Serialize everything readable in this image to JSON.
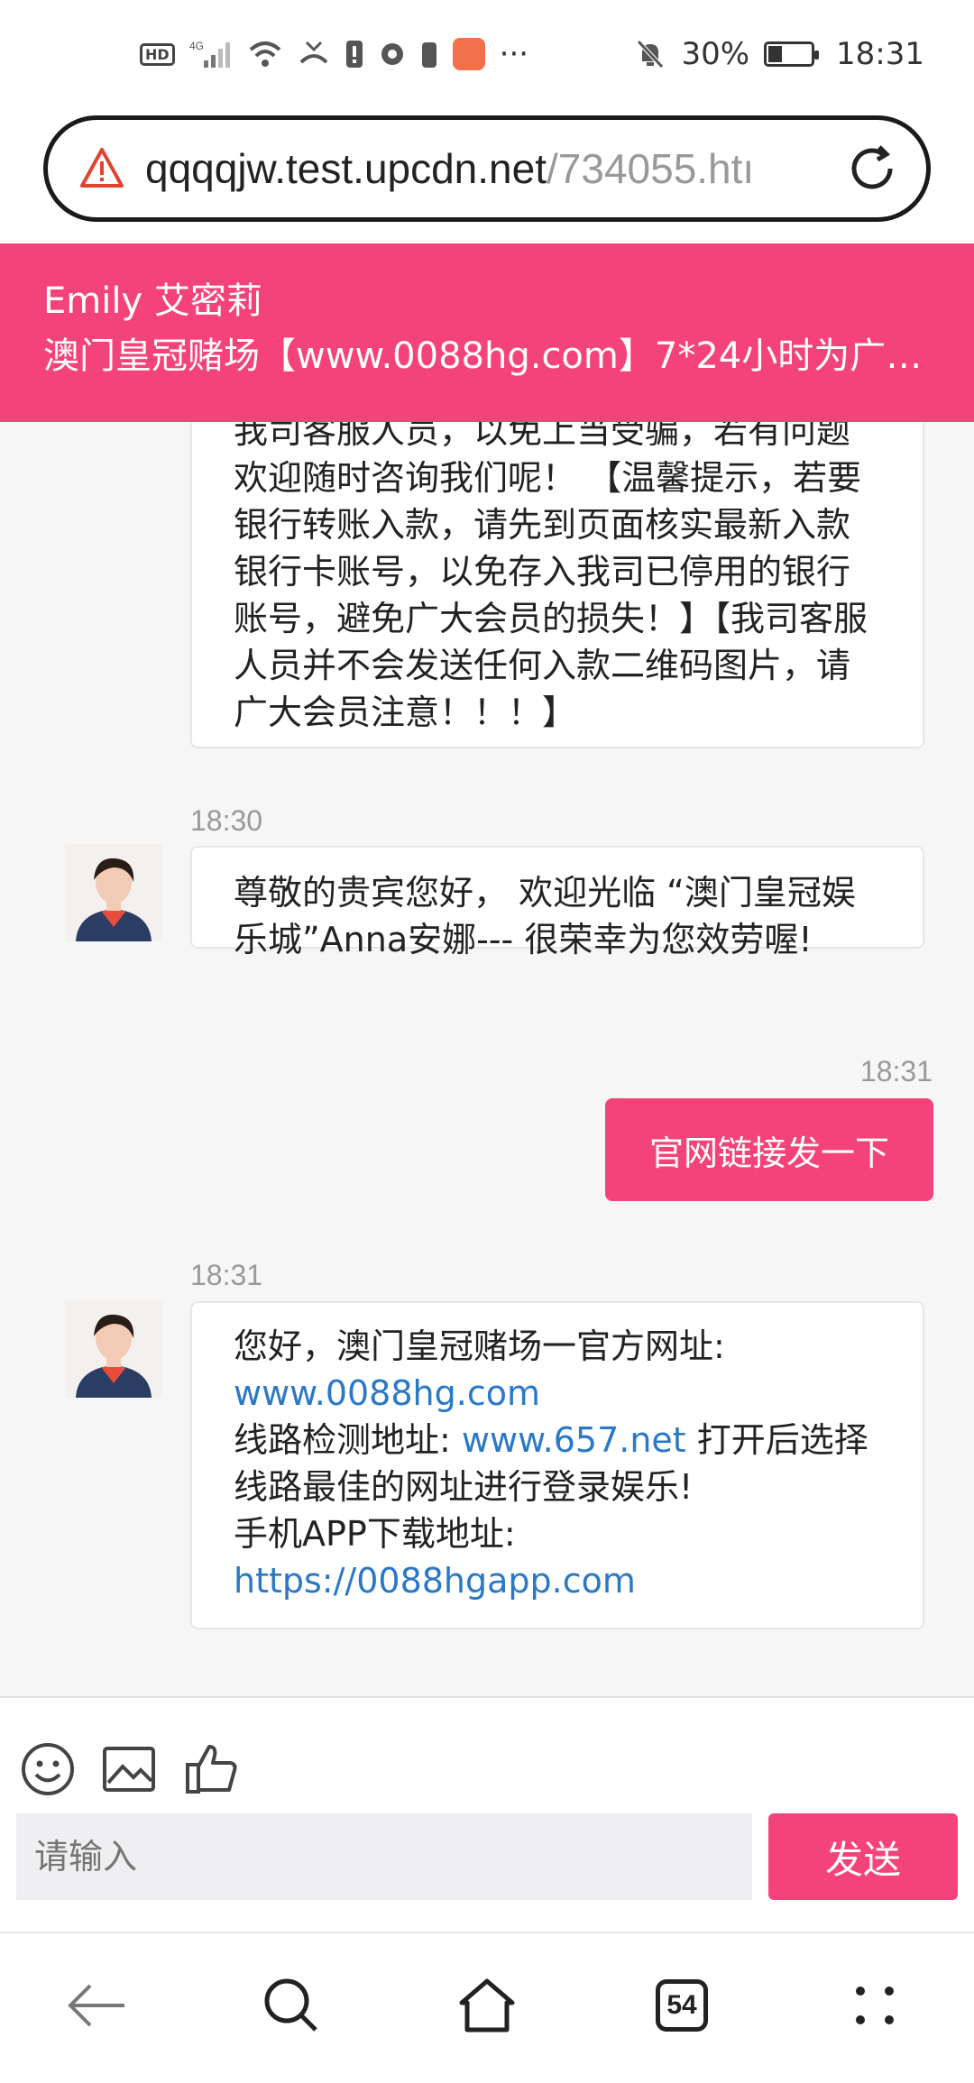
{
  "status_bar": {
    "network_label": "4G",
    "hd_label": "HD",
    "more_label": "···",
    "battery_percent": "30%",
    "time": "18:31"
  },
  "browser": {
    "url_host": "qqqqjw.test.upcdn.net",
    "url_path": "/734055.htı"
  },
  "header": {
    "agent_name": "Emily 艾密莉",
    "subtitle": "澳门皇冠赌场【www.0088hg.com】7*24小时为广…"
  },
  "messages": {
    "m1": {
      "text_partial": "我司客服人员，以免上当受骗，若有问题",
      "text": "欢迎随时咨询我们呢！ 【温馨提示，若要银行转账入款，请先到页面核实最新入款银行卡账号，以免存入我司已停用的银行账号，避免广大会员的损失！】【我司客服人员并不会发送任何入款二维码图片，请广大会员注意！！！】"
    },
    "m2": {
      "time": "18:30",
      "text": "尊敬的贵宾您好， 欢迎光临 “澳门皇冠娱乐城”Anna安娜--- 很荣幸为您效劳喔!"
    },
    "m3": {
      "time": "18:31",
      "text": "官网链接发一下"
    },
    "m4": {
      "time": "18:31",
      "line1": "您好，澳门皇冠赌场一官方网址:",
      "link1": "www.0088hg.com",
      "line2_prefix": "线路检测地址:",
      "link2": "www.657.net",
      "line2_suffix": " 打开后选择线路最佳的网址进行登录娱乐!",
      "line3": "手机APP下载地址:",
      "link3": "https://0088hgapp.com"
    }
  },
  "input": {
    "placeholder": "请输入",
    "send_label": "发送"
  },
  "nav": {
    "tabs_count": "54"
  },
  "colors": {
    "accent": "#f4437a",
    "link": "#2a78c6"
  }
}
